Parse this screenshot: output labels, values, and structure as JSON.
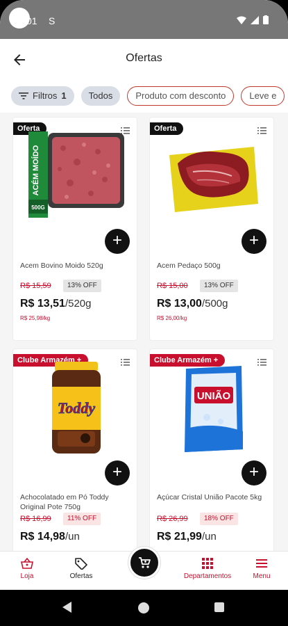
{
  "status_bar": {
    "time": "01",
    "extra": "S"
  },
  "header": {
    "title": "Ofertas"
  },
  "chips": {
    "filters": "Filtros",
    "filters_count": "1",
    "all": "Todos",
    "discount": "Produto com desconto",
    "more": "Leve e"
  },
  "products": [
    {
      "badge": "Oferta",
      "image_text": "ACÉM MOÍDO",
      "image_weight": "500G",
      "name": "Acem Bovino Moido 520g",
      "old_price": "R$ 15,59",
      "discount": "13% OFF",
      "price": "R$ 13,51",
      "unit": "/520g",
      "price_per_kg": "R$ 25,98/kg"
    },
    {
      "badge": "Oferta",
      "name": "Acem Pedaço 500g",
      "old_price": "R$ 15,00",
      "discount": "13% OFF",
      "price": "R$ 13,00",
      "unit": "/500g",
      "price_per_kg": "R$ 26,00/kg"
    },
    {
      "badge": "Clube Armazém +",
      "image_text": "Toddy",
      "name": "Achocolatado em Pó Toddy Original Pote 750g",
      "old_price": "R$ 16,99",
      "discount": "11% OFF",
      "price": "R$ 14,98",
      "unit": "/un"
    },
    {
      "badge": "Clube Armazém +",
      "image_text": "UNIÃO",
      "name": "Açúcar Cristal União Pacote 5kg",
      "old_price": "R$ 26,99",
      "discount": "18% OFF",
      "price": "R$ 21,99",
      "unit": "/un"
    }
  ],
  "bottom_nav": {
    "store": "Loja",
    "offers": "Ofertas",
    "departments": "Departamentos",
    "menu": "Menu"
  },
  "colors": {
    "brand_red": "#c8102e",
    "black": "#111111"
  }
}
